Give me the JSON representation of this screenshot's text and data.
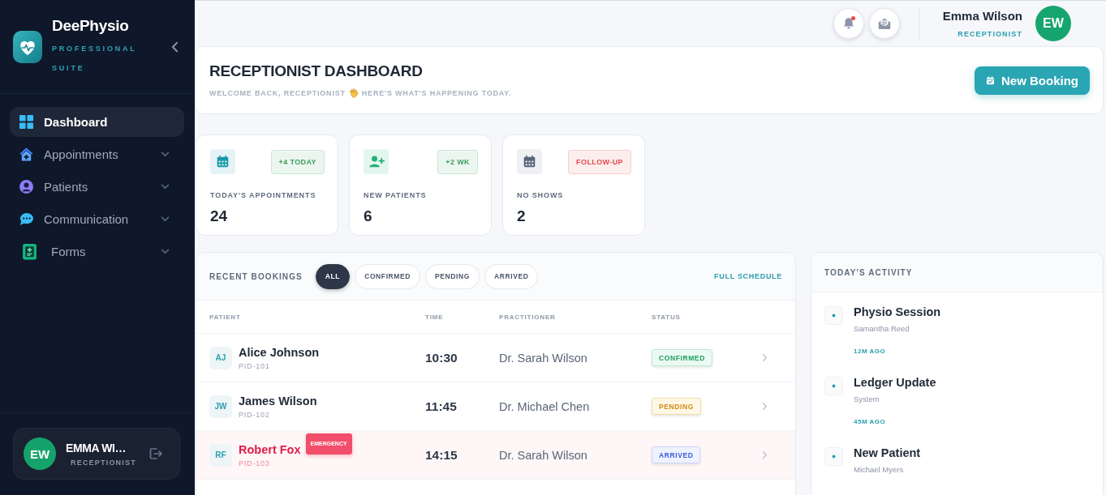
{
  "sidebar": {
    "brand": {
      "name": "DeePhysio",
      "tagline": "PROFESSIONAL SUITE"
    },
    "items": [
      {
        "label": "Dashboard",
        "kind": "link",
        "selected": true
      },
      {
        "label": "Appointments",
        "kind": "group",
        "selected": false
      },
      {
        "label": "Patients",
        "kind": "group",
        "selected": false
      },
      {
        "label": "Communication",
        "kind": "group",
        "selected": false
      },
      {
        "label": "Forms",
        "kind": "group",
        "selected": false
      }
    ],
    "user": {
      "initials": "EW",
      "name": "EMMA WI…",
      "role": "RECEPTIONIST"
    }
  },
  "header": {
    "notifications": {
      "unread": true
    },
    "user": {
      "name": "Emma Wilson",
      "role": "RECEPTIONIST",
      "initials": "EW"
    }
  },
  "page": {
    "title": "RECEPTIONIST DASHBOARD",
    "subtitle_start": "WELCOME BACK, RECEPTIONIST",
    "subtitle_end": "HERE'S WHAT'S HAPPENING TODAY.",
    "action": "New Booking"
  },
  "stats": [
    {
      "label": "TODAY'S APPOINTMENTS",
      "value": "24",
      "badge": {
        "text": "+4 TODAY",
        "color": "#3a9d5d"
      }
    },
    {
      "label": "NEW PATIENTS",
      "value": "6",
      "badge": {
        "text": "+2 WK",
        "color": "#3a9d5d"
      }
    },
    {
      "label": "NO SHOWS",
      "value": "2",
      "badge": {
        "text": "FOLLOW-UP",
        "color": "#e5484d"
      }
    }
  ],
  "bookings": {
    "title": "RECENT BOOKINGS",
    "filters": [
      {
        "label": "ALL",
        "selected": true
      },
      {
        "label": "CONFIRMED",
        "selected": false
      },
      {
        "label": "PENDING",
        "selected": false
      },
      {
        "label": "ARRIVED",
        "selected": false
      }
    ],
    "link": "FULL SCHEDULE",
    "columns": [
      "PATIENT",
      "TIME",
      "PRACTITIONER",
      "STATUS"
    ],
    "rows": [
      {
        "initials": "AJ",
        "name": "Alice Johnson",
        "pid": "PID-101",
        "time": "10:30",
        "practitioner": "Dr. Sarah Wilson",
        "status": {
          "text": "CONFIRMED",
          "kind": "confirmed"
        },
        "emergency": false
      },
      {
        "initials": "JW",
        "name": "James Wilson",
        "pid": "PID-102",
        "time": "11:45",
        "practitioner": "Dr. Michael Chen",
        "status": {
          "text": "PENDING",
          "kind": "pending"
        },
        "emergency": false
      },
      {
        "initials": "RF",
        "name": "Robert Fox",
        "flag": "EMERGENCY",
        "pid": "PID-103",
        "time": "14:15",
        "practitioner": "Dr. Sarah Wilson",
        "status": {
          "text": "ARRIVED",
          "kind": "arrived"
        },
        "emergency": true
      }
    ]
  },
  "activity": {
    "title": "TODAY'S ACTIVITY",
    "items": [
      {
        "title": "Physio Session",
        "subtitle": "Samantha Reed",
        "time": "12M AGO"
      },
      {
        "title": "Ledger Update",
        "subtitle": "System",
        "time": "45M AGO"
      },
      {
        "title": "New Patient",
        "subtitle": "Michael Myers"
      }
    ]
  }
}
